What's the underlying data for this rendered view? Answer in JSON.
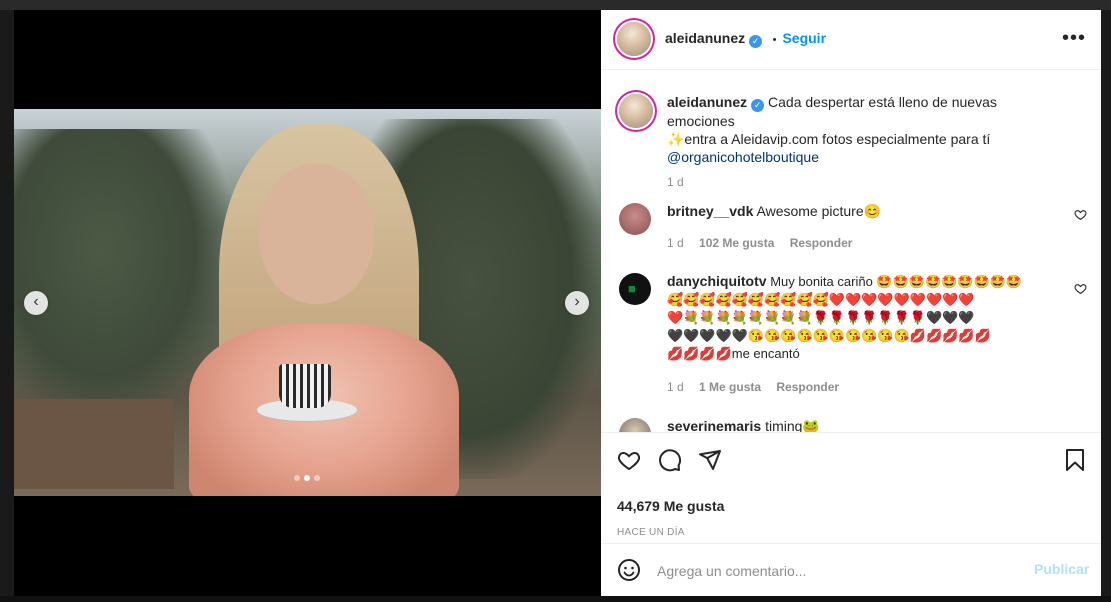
{
  "post": {
    "username": "aleidanunez",
    "follow_label": "Seguir",
    "separator": "•",
    "caption_line1": "Cada despertar está lleno de nuevas emociones",
    "caption_line2": "✨entra a Aleidavip.com fotos especialmente para tí",
    "caption_line3": "@organicohotelboutique",
    "caption_age": "1 d",
    "likes_label": "44,679 Me gusta",
    "time_label": "HACE UN DÍA"
  },
  "comments": [
    {
      "username": "britney__vdk",
      "text": "Awesome picture😊",
      "age": "1 d",
      "likes": "102 Me gusta",
      "reply_label": "Responder"
    },
    {
      "username": "danychiquitotv",
      "line1": "Muy bonita cariño 🤩🤩🤩🤩🤩🤩🤩🤩🤩",
      "line2": "🥰🥰🥰🥰🥰🥰🥰🥰🥰🥰❤️❤️❤️❤️❤️❤️❤️❤️❤️",
      "line3": "❤️💐💐💐💐💐💐💐💐🌹🌹🌹🌹🌹🌹🌹🖤🖤🖤",
      "line4": "🖤🖤🖤🖤🖤😘😘😘😘😘😘😘😘😘😘💋💋💋💋💋",
      "line5": "💋💋💋💋me encantó",
      "age": "1 d",
      "likes": "1 Me gusta",
      "reply_label": "Responder"
    },
    {
      "username": "severinemaris",
      "text": "timing🐸"
    }
  ],
  "addbar": {
    "placeholder": "Agrega un comentario...",
    "publish_label": "Publicar"
  },
  "icons": {
    "verified": "verified-badge-icon",
    "more": "more-options-icon",
    "like": "heart-icon",
    "comment": "comment-icon",
    "share": "share-icon",
    "save": "bookmark-icon",
    "emoji": "emoji-icon",
    "prev": "chevron-left-icon",
    "next": "chevron-right-icon"
  },
  "carousel": {
    "slides": 3,
    "active": 2
  },
  "colors": {
    "accent": "#0095f6",
    "publish_disabled": "#b2dffc",
    "verified": "#3897f0"
  }
}
